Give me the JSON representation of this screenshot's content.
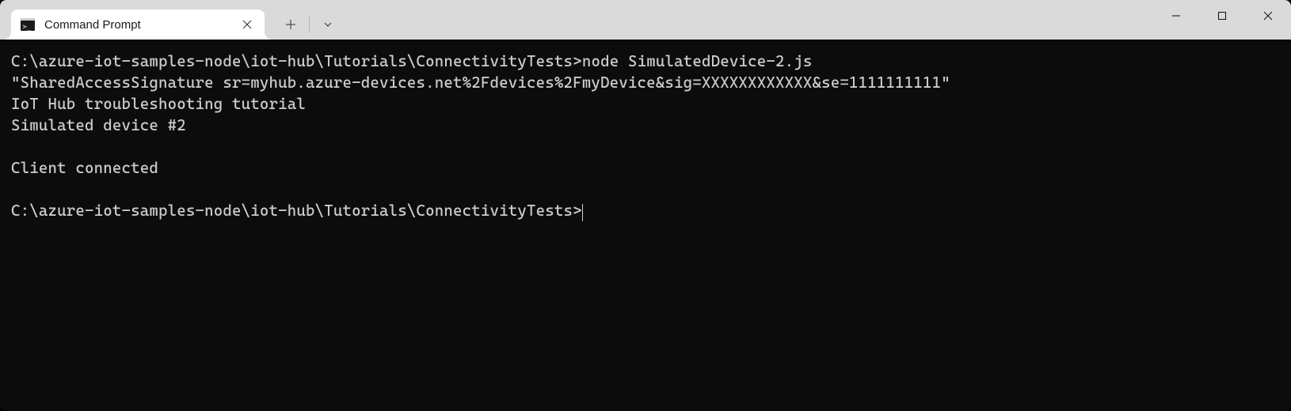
{
  "tab": {
    "title": "Command Prompt"
  },
  "terminal": {
    "line1_prompt": "C:\\azure-iot-samples-node\\iot-hub\\Tutorials\\ConnectivityTests>",
    "line1_cmd": "node SimulatedDevice-2.js",
    "line2": "\"SharedAccessSignature sr=myhub.azure-devices.net%2Fdevices%2FmyDevice&sig=XXXXXXXXXXXX&se=1111111111\"",
    "line3": "IoT Hub troubleshooting tutorial",
    "line4": "Simulated device #2",
    "line5": "",
    "line6": "Client connected",
    "line7": "",
    "line8_prompt": "C:\\azure-iot-samples-node\\iot-hub\\Tutorials\\ConnectivityTests>"
  }
}
